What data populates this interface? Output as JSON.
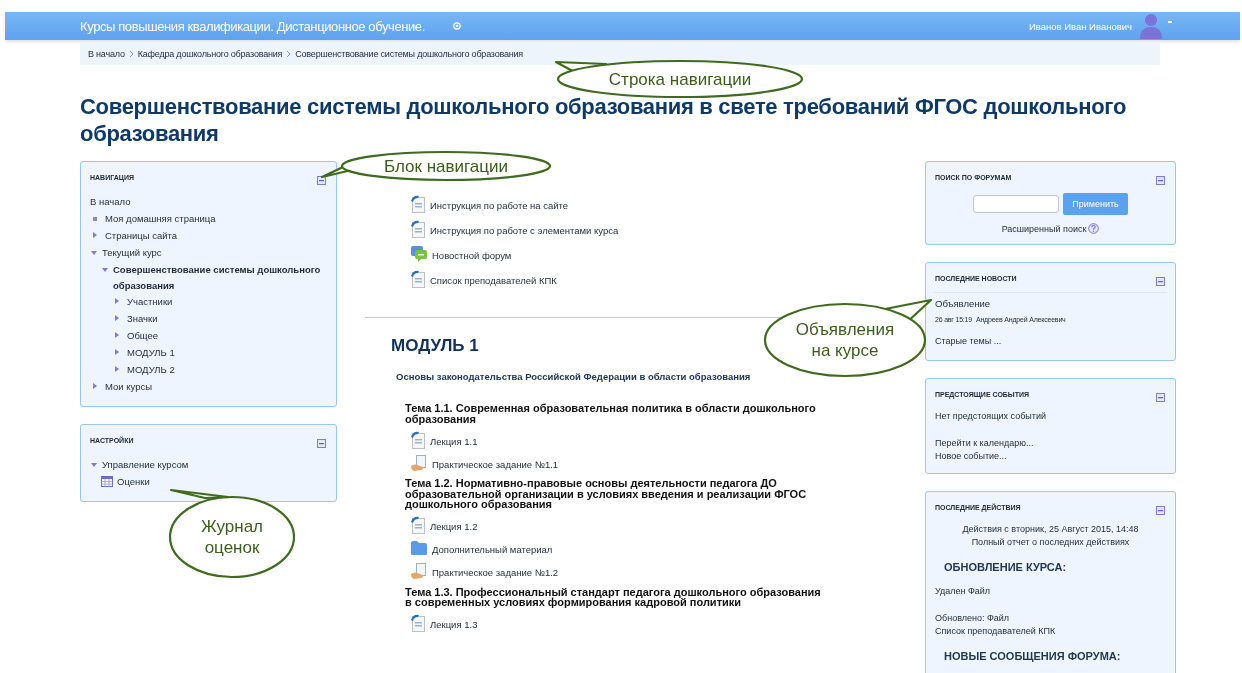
{
  "header": {
    "site_title": "Курсы повышения квалификации. Дистанционное обучение.",
    "user_name": "Иванов Иван Иванович"
  },
  "breadcrumb": [
    "В начало",
    "Кафедра дошкольного образования",
    "Совершенствование системы дошкольного образования"
  ],
  "page_title": "Совершенствование системы дошкольного образования в свете требований ФГОС дошкольного образования",
  "left_blocks": [
    {
      "title": "НАВИГАЦИЯ",
      "tree": [
        {
          "label": "В начало",
          "kind": "plain"
        },
        {
          "label": "Моя домашняя страница",
          "kind": "leaf"
        },
        {
          "label": "Страницы сайта",
          "kind": "branch",
          "expanded": false
        },
        {
          "label": "Текущий курс",
          "kind": "branch",
          "expanded": true,
          "children": [
            {
              "label": "Совершенствование системы дошкольного образования",
              "kind": "branch",
              "expanded": true,
              "current": true,
              "children": [
                {
                  "label": "Участники",
                  "kind": "branch",
                  "expanded": false
                },
                {
                  "label": "Значки",
                  "kind": "branch",
                  "expanded": false
                },
                {
                  "label": "Общее",
                  "kind": "branch",
                  "expanded": false
                },
                {
                  "label": "МОДУЛЬ 1",
                  "kind": "branch",
                  "expanded": false
                },
                {
                  "label": "МОДУЛЬ 2",
                  "kind": "branch",
                  "expanded": false
                }
              ]
            }
          ]
        },
        {
          "label": "Мои курсы",
          "kind": "branch",
          "expanded": false
        }
      ]
    },
    {
      "title": "НАСТРОЙКИ",
      "tree": [
        {
          "label": "Управление курсом",
          "kind": "branch",
          "expanded": true,
          "children": [
            {
              "label": "Оценки",
              "kind": "grades"
            }
          ]
        }
      ]
    }
  ],
  "intro_activities": [
    {
      "kind": "document",
      "label": "Инструкция по работе на сайте"
    },
    {
      "kind": "document",
      "label": "Инструкция по работе с элементами курса"
    },
    {
      "kind": "forum",
      "label": "Новостной форум"
    },
    {
      "kind": "document",
      "label": "Список преподавателей КПК"
    }
  ],
  "module": {
    "title": "МОДУЛЬ 1",
    "summary": "Основы законодательства Российской Федерации в области образования",
    "topics": [
      {
        "title": "Тема 1.1. Современная образовательная политика в области дошкольного образования",
        "activities": [
          {
            "kind": "document",
            "label": "Лекция 1.1"
          },
          {
            "kind": "assignment",
            "label": "Практическое задание №1.1"
          }
        ]
      },
      {
        "title": "Тема 1.2. Нормативно-правовые основы деятельности педагога ДО образовательной организации в условиях введения и реализации ФГОС дошкольного образования",
        "activities": [
          {
            "kind": "document",
            "label": "Лекция 1.2"
          },
          {
            "kind": "folder",
            "label": "Дополнительный материал"
          },
          {
            "kind": "assignment",
            "label": "Практическое задание №1.2"
          }
        ]
      },
      {
        "title": "Тема 1.3. Профессиональный стандарт педагога дошкольного образования в современных условиях формирования кадровой политики",
        "activities": [
          {
            "kind": "document",
            "label": "Лекция 1.3"
          }
        ]
      }
    ]
  },
  "right_blocks": [
    {
      "title": "ПОИСК ПО ФОРУМАМ",
      "lines": [
        {
          "kind": "search",
          "button": "Применить"
        },
        {
          "kind": "help_link",
          "text": "Расширенный поиск"
        }
      ]
    },
    {
      "title": "ПОСЛЕДНИЕ НОВОСТИ",
      "lines": [
        {
          "kind": "news",
          "title": "Объявление",
          "date": "26 авг 15:19",
          "author": "Андреев Андрей Алексеевич"
        },
        {
          "kind": "link",
          "text": "Старые темы ..."
        }
      ]
    },
    {
      "title": "ПРЕДСТОЯЩИЕ СОБЫТИЯ",
      "lines": [
        {
          "kind": "note",
          "text": "Нет предстоящих событий"
        },
        {
          "kind": "link",
          "text": "Перейти к календарю..."
        },
        {
          "kind": "link",
          "text": "Новое событие..."
        }
      ]
    },
    {
      "title": "ПОСЛЕДНИЕ ДЕЙСТВИЯ",
      "lines": [
        {
          "kind": "center",
          "text": "Действия с вторник, 25 Август 2015, 14:48"
        },
        {
          "kind": "center_link",
          "text": "Полный отчет о последних действиях"
        },
        {
          "kind": "heading",
          "text": "ОБНОВЛЕНИЕ КУРСА:"
        },
        {
          "kind": "note",
          "text": "Удален Файл"
        },
        {
          "kind": "text",
          "text": "Обновлено: Файл"
        },
        {
          "kind": "link",
          "text": "Список преподавателей КПК"
        },
        {
          "kind": "heading",
          "text": "НОВЫЕ СООБЩЕНИЯ ФОРУМА:"
        }
      ]
    }
  ],
  "annotations": [
    {
      "text": "Строка навигации"
    },
    {
      "text": "Блок навигации"
    },
    {
      "text": "Объявления на курсе"
    },
    {
      "text": "Журнал оценок"
    }
  ]
}
